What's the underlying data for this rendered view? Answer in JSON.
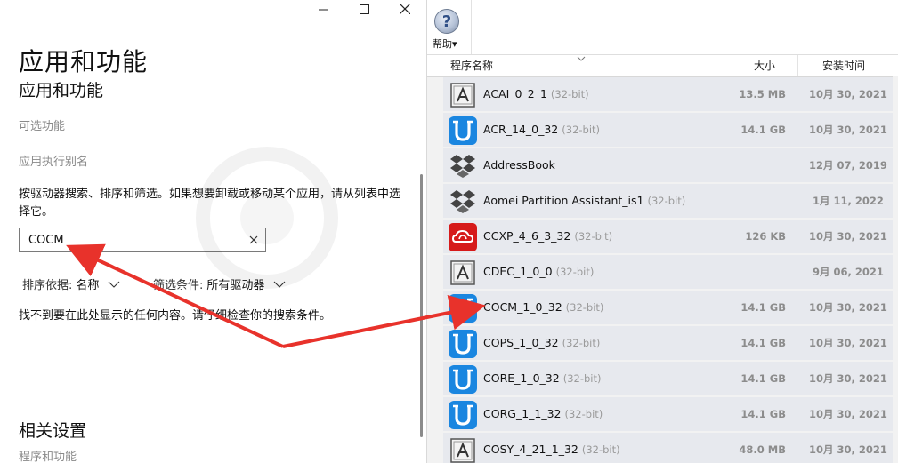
{
  "settings": {
    "title_big": "应用和功能",
    "title_sub": "应用和功能",
    "link_optional": "可选功能",
    "link_alias": "应用执行别名",
    "description": "按驱动器搜索、排序和筛选。如果想要卸载或移动某个应用，请从列表中选择它。",
    "search_value": "COCM",
    "sort_label": "排序依据:",
    "sort_value": "名称",
    "filter_label": "筛选条件:",
    "filter_value": "所有驱动器",
    "no_result": "找不到要在此处显示的任何内容。请仔细检查你的搜索条件。",
    "related_title": "相关设置",
    "related_link": "程序和功能"
  },
  "toolbar": {
    "help_label": "帮助▾"
  },
  "columns": {
    "name": "程序名称",
    "size": "大小",
    "date": "安装时间"
  },
  "programs": [
    {
      "name": "ACAI_0_2_1",
      "bit": "(32-bit)",
      "size": "13.5 MB",
      "date": "10月 30, 2021",
      "icon": "adobe-box-icon"
    },
    {
      "name": "ACR_14_0_32",
      "bit": "(32-bit)",
      "size": "14.1 GB",
      "date": "10月 30, 2021",
      "icon": "blue-u-icon"
    },
    {
      "name": "AddressBook",
      "bit": "",
      "size": "",
      "date": "12月 07, 2019",
      "icon": "dropbox-icon"
    },
    {
      "name": "Aomei Partition Assistant_is1",
      "bit": "(32-bit)",
      "size": "",
      "date": "1月 11, 2022",
      "icon": "dropbox-icon"
    },
    {
      "name": "CCXP_4_6_3_32",
      "bit": "(32-bit)",
      "size": "126 KB",
      "date": "10月 30, 2021",
      "icon": "creative-cloud-icon"
    },
    {
      "name": "CDEC_1_0_0",
      "bit": "(32-bit)",
      "size": "",
      "date": "9月 06, 2021",
      "icon": "adobe-box-icon"
    },
    {
      "name": "COCM_1_0_32",
      "bit": "(32-bit)",
      "size": "14.1 GB",
      "date": "10月 30, 2021",
      "icon": "blue-u-icon"
    },
    {
      "name": "COPS_1_0_32",
      "bit": "(32-bit)",
      "size": "14.1 GB",
      "date": "10月 30, 2021",
      "icon": "blue-u-icon"
    },
    {
      "name": "CORE_1_0_32",
      "bit": "(32-bit)",
      "size": "14.1 GB",
      "date": "10月 30, 2021",
      "icon": "blue-u-icon"
    },
    {
      "name": "CORG_1_1_32",
      "bit": "(32-bit)",
      "size": "14.1 GB",
      "date": "10月 30, 2021",
      "icon": "blue-u-icon"
    },
    {
      "name": "COSY_4_21_1_32",
      "bit": "(32-bit)",
      "size": "48.0 MB",
      "date": "10月 30, 2021",
      "icon": "adobe-box-icon"
    }
  ],
  "colors": {
    "row_bg": "#e7e9ee",
    "arrow": "#e8322b",
    "accent_blue": "#1a86e0",
    "cc_red": "#d61a1a"
  }
}
